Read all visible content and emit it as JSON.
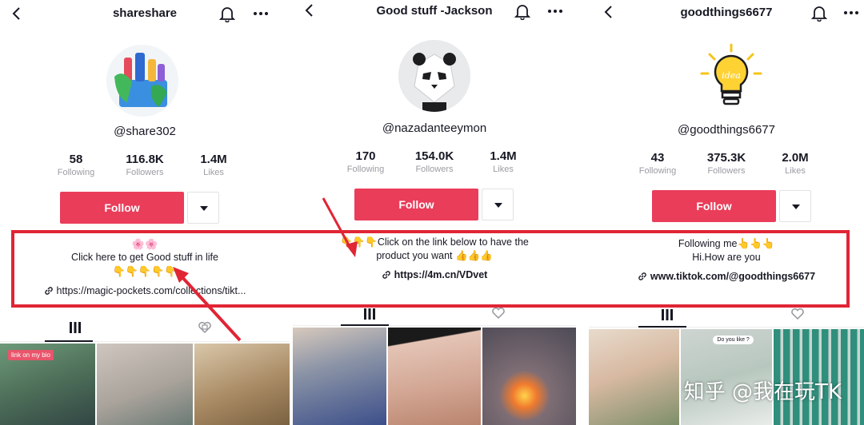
{
  "panels": [
    {
      "handle": "shareshare",
      "username": "@share302",
      "stats": [
        {
          "num": "58",
          "label": "Following"
        },
        {
          "num": "116.8K",
          "label": "Followers"
        },
        {
          "num": "1.4M",
          "label": "Likes"
        }
      ],
      "follow_label": "Follow",
      "bio_top_emoji": "🌸🌸",
      "bio_line1": "Click here to get Good stuff in life",
      "bio_line2": "👇👇👇👇👇",
      "link": "https://magic-pockets.com/collections/tikt..."
    },
    {
      "handle": "Good stuff -Jackson",
      "username": "@nazadanteeymon",
      "stats": [
        {
          "num": "170",
          "label": "Following"
        },
        {
          "num": "154.0K",
          "label": "Followers"
        },
        {
          "num": "1.4M",
          "label": "Likes"
        }
      ],
      "follow_label": "Follow",
      "bio_line1": "👇👇👇Click on the link below to have the",
      "bio_line2": "product you want 👍👍👍",
      "link": "https://4m.cn/VDvet"
    },
    {
      "handle": "goodthings6677",
      "username": "@goodthings6677",
      "stats": [
        {
          "num": "43",
          "label": "Following"
        },
        {
          "num": "375.3K",
          "label": "Followers"
        },
        {
          "num": "2.0M",
          "label": "Likes"
        }
      ],
      "follow_label": "Follow",
      "avatar_text": "idea",
      "bio_line1": "Following me👆👆👆",
      "bio_line2": "Hi.How are you",
      "link": "www.tiktok.com/@goodthings6677"
    }
  ],
  "thumbs": {
    "label_bio": "link on my bio",
    "bubble_like": "Do you like ?"
  },
  "watermark": "知乎 @我在玩TK",
  "colors": {
    "follow": "#ea3d5a",
    "highlight": "#e02535",
    "secondary_text": "#9b9ca3"
  }
}
